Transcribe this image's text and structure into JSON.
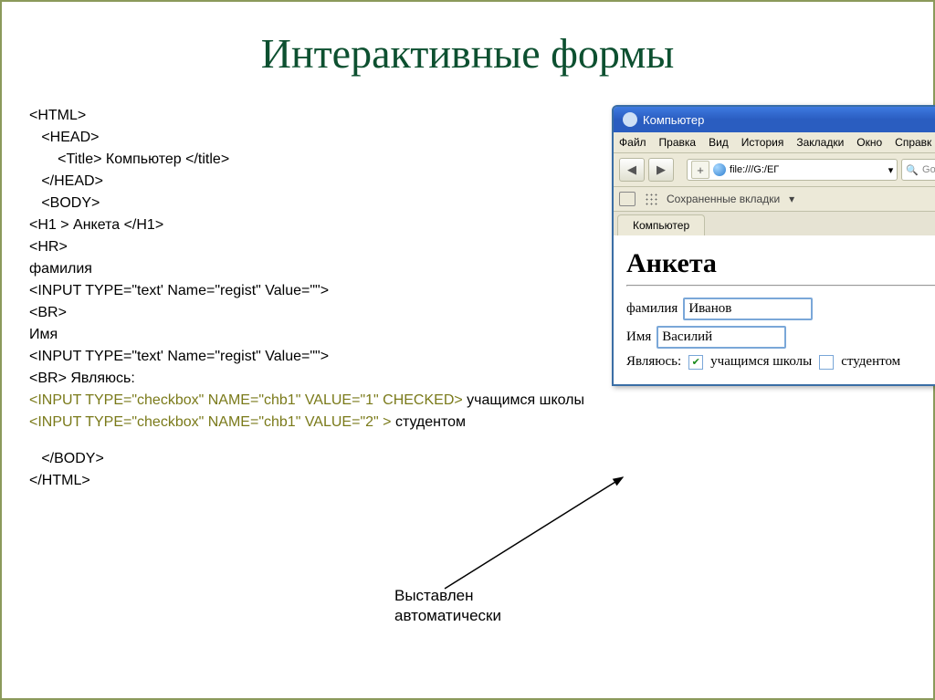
{
  "slide": {
    "title": "Интерактивные формы"
  },
  "code": {
    "l1": "<HTML>",
    "l2": "   <HEAD>",
    "l3": "       <Title> Компьютер </title>",
    "l4": "   </HEAD>",
    "l5": "   <BODY>",
    "l6": "<H1 > Анкета </H1>",
    "l7": "<HR>",
    "l8": "фамилия",
    "l9": "<INPUT TYPE=\"text' Name=\"regist\" Value=\"\">",
    "l10": "<BR>",
    "l11": "Имя",
    "l12": "<INPUT TYPE=\"text' Name=\"regist\" Value=\"\">",
    "l13": "<BR> Являюсь:",
    "l14": "<INPUT TYPE=\"checkbox\" NAME=\"chb1\" VALUE=\"1\" CHECKED> ",
    "l14b": "учащимся школы",
    "l15": "<INPUT TYPE=\"checkbox\" NAME=\"chb1\" VALUE=\"2\" > ",
    "l15b": "студентом",
    "l16": "   </BODY>",
    "l17": "</HTML>"
  },
  "browser": {
    "title": "Компьютер",
    "menu": {
      "file": "Файл",
      "edit": "Правка",
      "view": "Вид",
      "history": "История",
      "bookmarks_menu": "Закладки",
      "window_menu": "Окно",
      "help": "Справк"
    },
    "url": "file:///G:/ЕГ",
    "search_placeholder": "Google",
    "bookmarks_label": "Сохраненные вкладки",
    "tab": "Компьютер"
  },
  "page": {
    "heading": "Анкета",
    "label_surname": "фамилия",
    "val_surname": "Иванов",
    "label_name": "Имя",
    "val_name": "Василий",
    "label_am": "Являюсь:",
    "opt_school": "учащимся школы",
    "opt_student": "студентом",
    "check_mark": "✔"
  },
  "annotation": {
    "line1": "Выставлен",
    "line2": "автоматически"
  },
  "chevron": "»"
}
